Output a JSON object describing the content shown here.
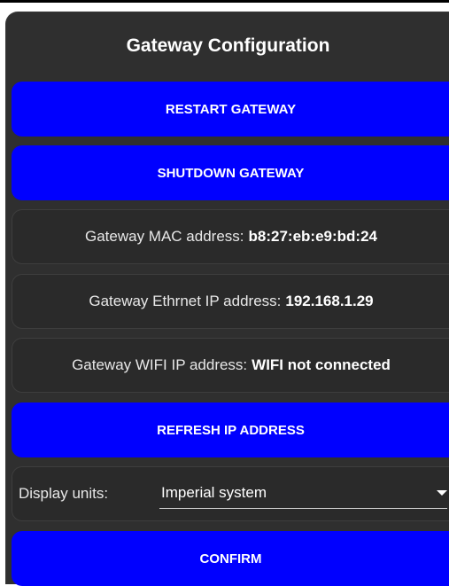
{
  "title": "Gateway Configuration",
  "buttons": {
    "restart": "RESTART GATEWAY",
    "shutdown": "SHUTDOWN GATEWAY",
    "refresh_ip": "REFRESH IP ADDRESS",
    "confirm": "CONFIRM"
  },
  "info": {
    "mac_label": "Gateway MAC address:",
    "mac_value": "b8:27:eb:e9:bd:24",
    "eth_label": "Gateway Ethrnet IP address:",
    "eth_value": "192.168.1.29",
    "wifi_label": "Gateway WIFI IP address:",
    "wifi_value": "WIFI not connected"
  },
  "units": {
    "label": "Display units:",
    "selected": "Imperial system"
  },
  "colors": {
    "accent": "#0000ff",
    "panel": "#2f2f2f"
  }
}
